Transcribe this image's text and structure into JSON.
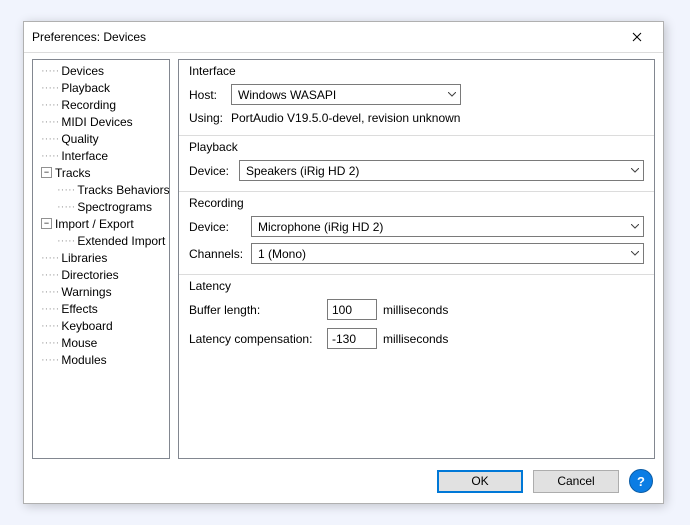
{
  "window": {
    "title": "Preferences: Devices"
  },
  "tree": {
    "items0": "Devices",
    "items1": "Playback",
    "items2": "Recording",
    "items3": "MIDI Devices",
    "items4": "Quality",
    "items5": "Interface",
    "tracks": {
      "label": "Tracks",
      "child0": "Tracks Behaviors",
      "child1": "Spectrograms"
    },
    "impexp": {
      "label": "Import / Export",
      "child0": "Extended Import"
    },
    "items6": "Libraries",
    "items7": "Directories",
    "items8": "Warnings",
    "items9": "Effects",
    "items10": "Keyboard",
    "items11": "Mouse",
    "items12": "Modules"
  },
  "panel": {
    "interface": {
      "title": "Interface",
      "host_label": "Host:",
      "host_value": "Windows WASAPI",
      "using_label": "Using:",
      "using_value": "PortAudio V19.5.0-devel, revision unknown"
    },
    "playback": {
      "title": "Playback",
      "device_label": "Device:",
      "device_value": "Speakers (iRig HD 2)"
    },
    "recording": {
      "title": "Recording",
      "device_label": "Device:",
      "device_value": "Microphone (iRig HD 2)",
      "channels_label": "Channels:",
      "channels_value": "1 (Mono)"
    },
    "latency": {
      "title": "Latency",
      "buffer_label": "Buffer length:",
      "buffer_value": "100",
      "buffer_unit": "milliseconds",
      "comp_label": "Latency compensation:",
      "comp_value": "-130",
      "comp_unit": "milliseconds"
    }
  },
  "footer": {
    "ok": "OK",
    "cancel": "Cancel",
    "help": "?"
  }
}
